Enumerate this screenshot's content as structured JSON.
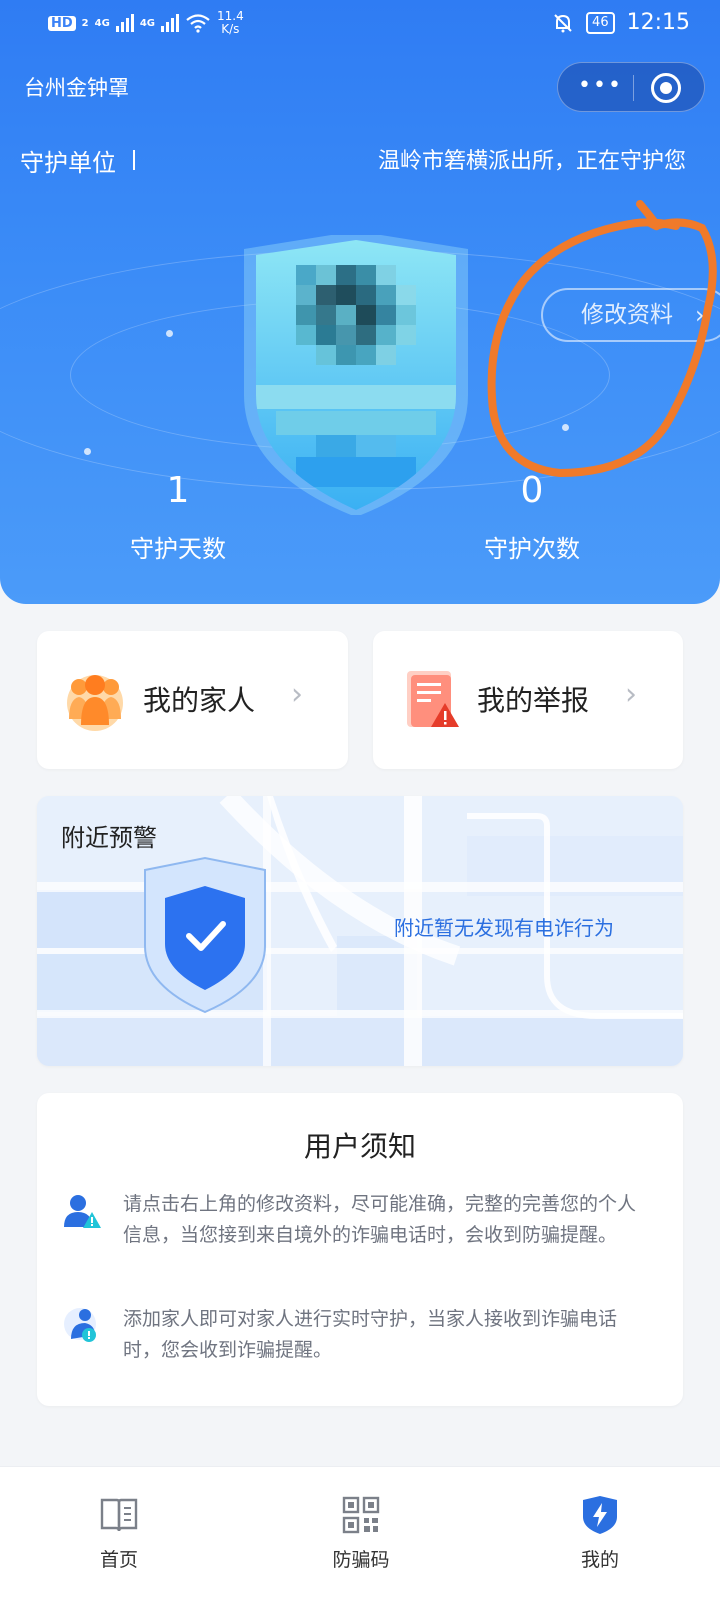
{
  "status_bar": {
    "hd": "HD",
    "sim": "2",
    "net1": "4G",
    "net2": "4G",
    "speed_value": "11.4",
    "speed_unit": "K/s",
    "battery": "46",
    "time": "12:15"
  },
  "header": {
    "app_title": "台州金钟罩",
    "more_icon": "more-dots-icon",
    "close_icon": "target-circle-icon"
  },
  "guard": {
    "label": "守护单位",
    "marquee": "温岭市箬横派出所，正在守护您"
  },
  "profile": {
    "edit_label": "修改资料",
    "edit_chevron": "›"
  },
  "stats": {
    "days_value": "1",
    "days_label": "守护天数",
    "times_value": "0",
    "times_label": "守护次数"
  },
  "entries": {
    "family_label": "我的家人",
    "family_icon": "family-icon",
    "report_label": "我的举报",
    "report_icon": "report-icon",
    "chevron": "›"
  },
  "nearby": {
    "title": "附近预警",
    "message": "附近暂无发现有电诈行为"
  },
  "notice": {
    "title": "用户须知",
    "items": [
      {
        "text": "请点击右上角的修改资料，尽可能准确，完整的完善您的个人信息，当您接到来自境外的诈骗电话时，会收到防骗提醒。",
        "icon": "user-warning-icon"
      },
      {
        "text": "添加家人即可对家人进行实时守护，当家人接收到诈骗电话时，您会收到诈骗提醒。",
        "icon": "family-warning-icon"
      }
    ]
  },
  "tabbar": {
    "tabs": [
      {
        "label": "首页",
        "icon": "book-icon"
      },
      {
        "label": "防骗码",
        "icon": "qr-code-icon"
      },
      {
        "label": "我的",
        "icon": "shield-bolt-icon"
      }
    ]
  },
  "colors": {
    "primary": "#2f7cf3",
    "active_tab": "#2b6fe0",
    "annotation": "#f07a2a"
  }
}
